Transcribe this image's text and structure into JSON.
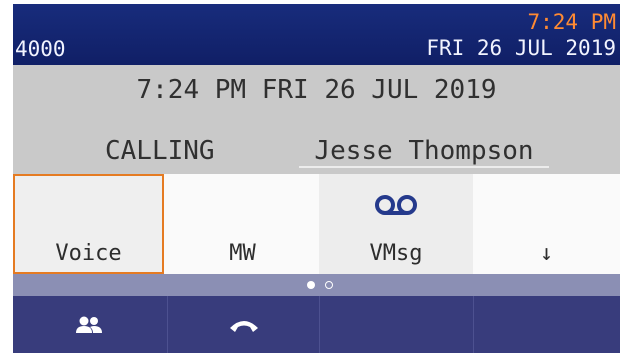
{
  "header": {
    "extension": "4000",
    "time": "7:24 PM",
    "date": "FRI 26 JUL 2019"
  },
  "info": {
    "datetime": "7:24 PM FRI 26 JUL 2019",
    "call_state": "CALLING",
    "caller_name": "Jesse Thompson"
  },
  "softkeys": [
    {
      "label": "Voice",
      "icon": "",
      "selected": true
    },
    {
      "label": "MW",
      "icon": ""
    },
    {
      "label": "VMsg",
      "icon": "voicemail-icon"
    },
    {
      "label": "↓",
      "icon": ""
    }
  ],
  "pager": {
    "pages": 2,
    "current": 1
  },
  "function_bar": [
    {
      "icon": "contacts-icon"
    },
    {
      "icon": "hang-up-icon"
    },
    {
      "icon": ""
    },
    {
      "icon": ""
    }
  ],
  "colors": {
    "header_bg": "#162a77",
    "time_accent": "#ff8a33",
    "info_bg": "#c9c9c9",
    "selected_border": "#e57b22",
    "funcbar_bg": "#383c7c"
  }
}
